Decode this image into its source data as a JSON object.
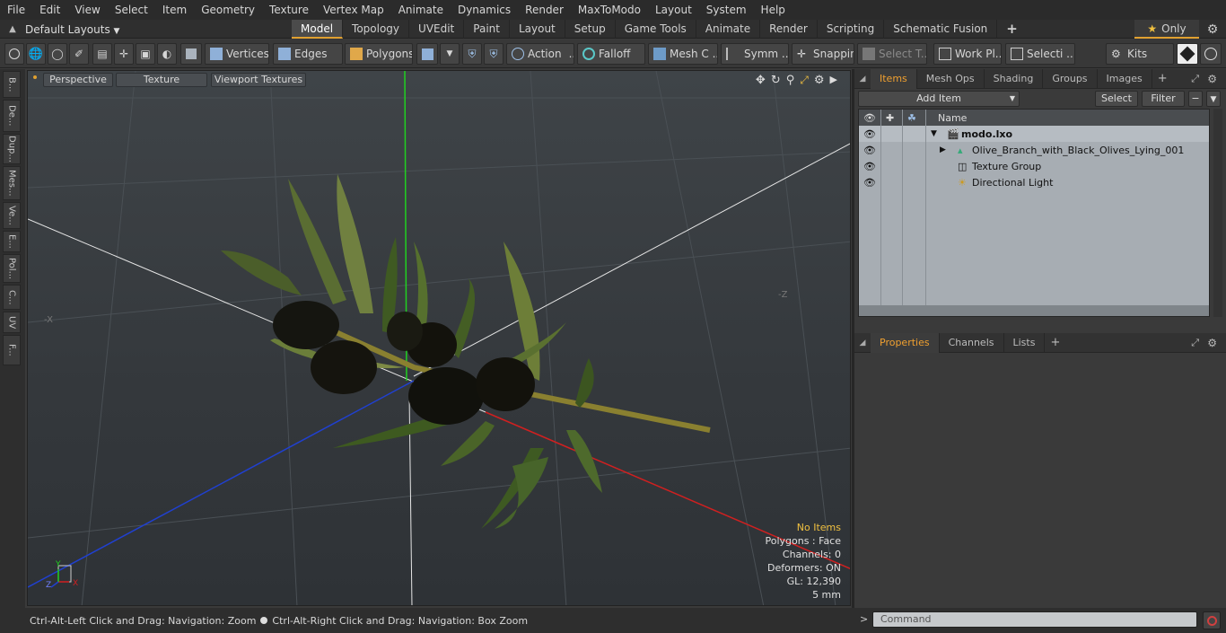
{
  "menu": [
    "File",
    "Edit",
    "View",
    "Select",
    "Item",
    "Geometry",
    "Texture",
    "Vertex Map",
    "Animate",
    "Dynamics",
    "Render",
    "MaxToModo",
    "Layout",
    "System",
    "Help"
  ],
  "layouts": {
    "label": "Default Layouts"
  },
  "tabs": [
    "Model",
    "Topology",
    "UVEdit",
    "Paint",
    "Layout",
    "Setup",
    "Game Tools",
    "Animate",
    "Render",
    "Scripting",
    "Schematic Fusion"
  ],
  "active_tab": "Model",
  "only_label": "Only",
  "toolbar": {
    "vertices": "Vertices",
    "edges": "Edges",
    "polygons": "Polygons",
    "action": "Action",
    "falloff": "Falloff",
    "mesh": "Mesh C ...",
    "symm": "Symm ...",
    "snapping": "Snapping",
    "select_t": "Select T...",
    "work_pl": "Work Pl...",
    "selecti": "Selecti ...",
    "kits": "Kits"
  },
  "left_tabs": [
    "B...",
    "De...",
    "Dup...",
    "Mes...",
    "Ve...",
    "E...",
    "Pol...",
    "C...",
    "UV",
    "F..."
  ],
  "viewport": {
    "perspective": "Perspective",
    "texture": "Texture",
    "viewport_textures": "Viewport Textures",
    "info": {
      "items": "No Items",
      "polygons": "Polygons : Face",
      "channels": "Channels: 0",
      "deformers": "Deformers: ON",
      "gl": "GL: 12,390",
      "scale": "5 mm"
    },
    "axis_labels": {
      "x": "X",
      "y": "Y",
      "z": "Z"
    }
  },
  "status": {
    "hint1": "Ctrl-Alt-Left Click and Drag: Navigation: Zoom",
    "hint2": "Ctrl-Alt-Right Click and Drag: Navigation: Box Zoom"
  },
  "items_panel": {
    "tabs": [
      "Items",
      "Mesh Ops",
      "Shading",
      "Groups",
      "Images"
    ],
    "add_item": "Add Item",
    "select": "Select",
    "filter": "Filter",
    "column_name": "Name",
    "rows": [
      {
        "name": "modo.lxo",
        "bold": true
      },
      {
        "name": "Olive_Branch_with_Black_Olives_Lying_001",
        "bold": false
      },
      {
        "name": "Texture Group",
        "bold": false
      },
      {
        "name": "Directional Light",
        "bold": false
      }
    ]
  },
  "props_panel": {
    "tabs": [
      "Properties",
      "Channels",
      "Lists"
    ]
  },
  "command": {
    "placeholder": "Command"
  },
  "colors": {
    "accent": "#e0a030",
    "axis_x": "#d02020",
    "axis_y": "#20d020",
    "axis_z": "#2040d0",
    "info_highlight": "#f0c040"
  }
}
